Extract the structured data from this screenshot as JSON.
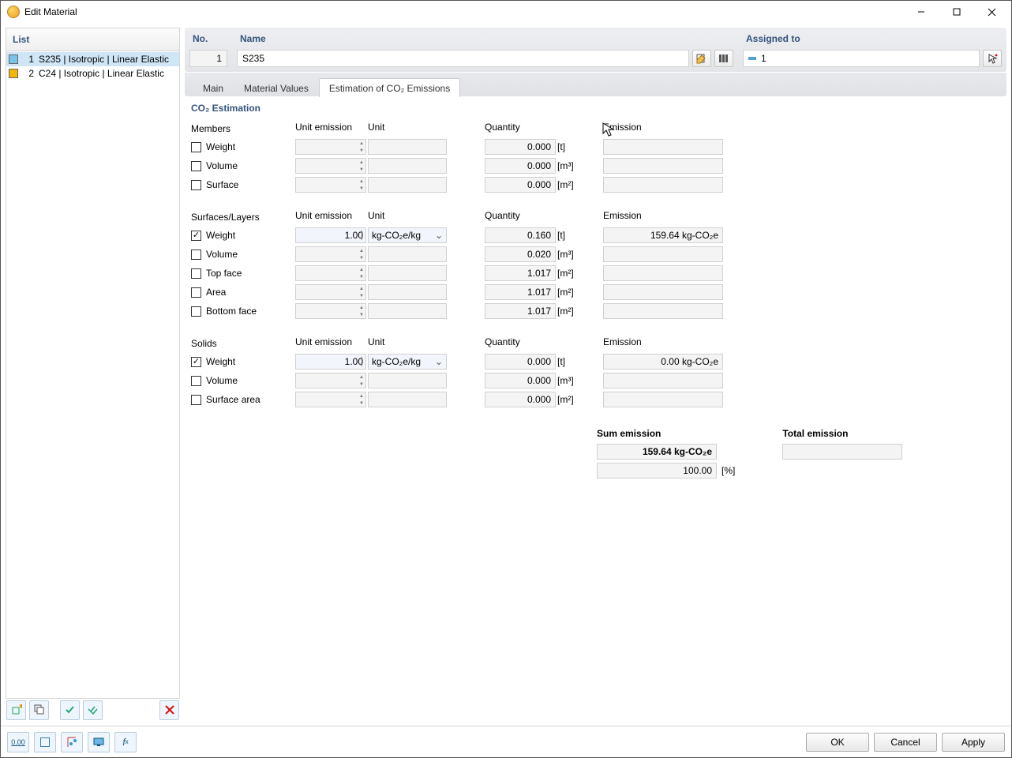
{
  "window": {
    "title": "Edit Material"
  },
  "sidebar": {
    "header": "List",
    "items": [
      {
        "idx": "1",
        "label": "S235 | Isotropic | Linear Elastic",
        "color": "#7bc3e8",
        "selected": true
      },
      {
        "idx": "2",
        "label": "C24 | Isotropic | Linear Elastic",
        "color": "#f4b400",
        "selected": false
      }
    ]
  },
  "header": {
    "no_label": "No.",
    "no_value": "1",
    "name_label": "Name",
    "name_value": "S235",
    "assigned_label": "Assigned to",
    "assigned_value": "1"
  },
  "tabs": [
    {
      "label": "Main",
      "active": false
    },
    {
      "label": "Material Values",
      "active": false
    },
    {
      "label": "Estimation of CO₂ Emissions",
      "active": true
    }
  ],
  "panel": {
    "title": "CO₂ Estimation",
    "col_headers": {
      "unitemission": "Unit emission",
      "unit": "Unit",
      "quantity": "Quantity",
      "emission": "Emission"
    },
    "groups": [
      {
        "name": "Members",
        "rows": [
          {
            "label": "Weight",
            "checked": false,
            "ue": "",
            "unit": "",
            "qty": "0.000",
            "qu": "[t]",
            "emis": ""
          },
          {
            "label": "Volume",
            "checked": false,
            "ue": "",
            "unit": "",
            "qty": "0.000",
            "qu": "[m³]",
            "emis": ""
          },
          {
            "label": "Surface",
            "checked": false,
            "ue": "",
            "unit": "",
            "qty": "0.000",
            "qu": "[m²]",
            "emis": ""
          }
        ]
      },
      {
        "name": "Surfaces/Layers",
        "rows": [
          {
            "label": "Weight",
            "checked": true,
            "ue": "1.00",
            "unit": "kg-CO₂e/kg",
            "qty": "0.160",
            "qu": "[t]",
            "emis": "159.64 kg-CO₂e"
          },
          {
            "label": "Volume",
            "checked": false,
            "ue": "",
            "unit": "",
            "qty": "0.020",
            "qu": "[m³]",
            "emis": ""
          },
          {
            "label": "Top face",
            "checked": false,
            "ue": "",
            "unit": "",
            "qty": "1.017",
            "qu": "[m²]",
            "emis": ""
          },
          {
            "label": "Area",
            "checked": false,
            "ue": "",
            "unit": "",
            "qty": "1.017",
            "qu": "[m²]",
            "emis": ""
          },
          {
            "label": "Bottom face",
            "checked": false,
            "ue": "",
            "unit": "",
            "qty": "1.017",
            "qu": "[m²]",
            "emis": ""
          }
        ]
      },
      {
        "name": "Solids",
        "rows": [
          {
            "label": "Weight",
            "checked": true,
            "ue": "1.00",
            "unit": "kg-CO₂e/kg",
            "qty": "0.000",
            "qu": "[t]",
            "emis": "0.00 kg-CO₂e"
          },
          {
            "label": "Volume",
            "checked": false,
            "ue": "",
            "unit": "",
            "qty": "0.000",
            "qu": "[m³]",
            "emis": ""
          },
          {
            "label": "Surface area",
            "checked": false,
            "ue": "",
            "unit": "",
            "qty": "0.000",
            "qu": "[m²]",
            "emis": ""
          }
        ]
      }
    ],
    "summary": {
      "sum_label": "Sum emission",
      "sum_value": "159.64 kg-CO₂e",
      "sum_pct": "100.00",
      "sum_pct_unit": "[%]",
      "total_label": "Total emission",
      "total_value": ""
    }
  },
  "footer": {
    "ok": "OK",
    "cancel": "Cancel",
    "apply": "Apply"
  }
}
